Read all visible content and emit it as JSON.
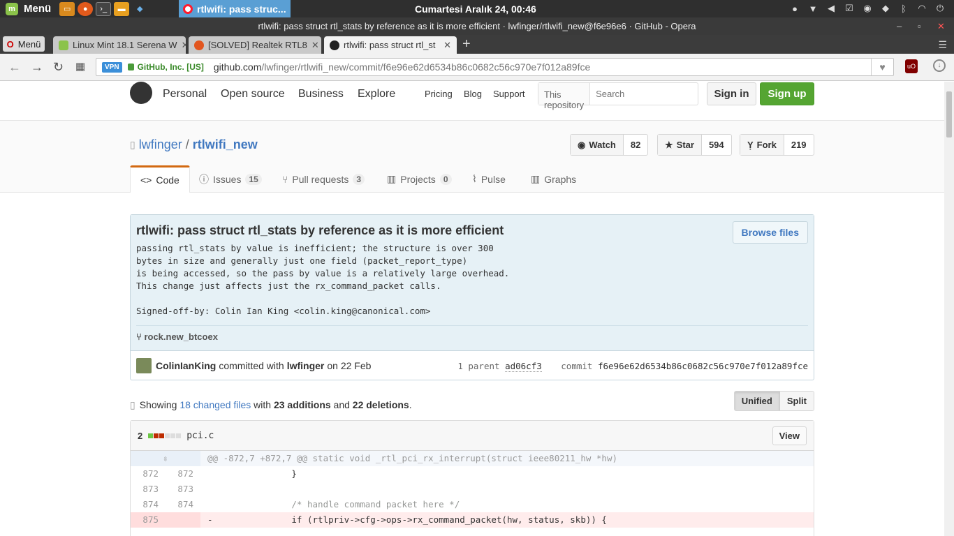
{
  "panel": {
    "menu_label": "Menü",
    "active_task": "rtlwifi: pass struc...",
    "clock": "Cumartesi Aralık 24, 00:46"
  },
  "window": {
    "title": "rtlwifi: pass struct rtl_stats by reference as it is more efficient · lwfinger/rtlwifi_new@f6e96e6 · GitHub - Opera"
  },
  "tabs": {
    "opera_menu": "Menü",
    "items": [
      {
        "label": "Linux Mint 18.1 Serena W"
      },
      {
        "label": "[SOLVED] Realtek RTL8"
      },
      {
        "label": "rtlwifi: pass struct rtl_st"
      }
    ]
  },
  "toolbar": {
    "vpn": "VPN",
    "cert": "GitHub, Inc. [US]",
    "url_host": "github.com",
    "url_path": "/lwfinger/rtlwifi_new/commit/f6e96e62d6534b86c0682c56c970e7f012a89fce"
  },
  "gh": {
    "nav": [
      "Personal",
      "Open source",
      "Business",
      "Explore"
    ],
    "sub": [
      "Pricing",
      "Blog",
      "Support"
    ],
    "search_scope": "This repository",
    "search_placeholder": "Search",
    "signin": "Sign in",
    "signup": "Sign up"
  },
  "repo": {
    "owner": "lwfinger",
    "sep": "/",
    "name": "rtlwifi_new",
    "watch": {
      "label": "Watch",
      "count": "82"
    },
    "star": {
      "label": "Star",
      "count": "594"
    },
    "fork": {
      "label": "Fork",
      "count": "219"
    },
    "tabs": {
      "code": "Code",
      "issues": "Issues",
      "issues_count": "15",
      "pulls": "Pull requests",
      "pulls_count": "3",
      "projects": "Projects",
      "projects_count": "0",
      "pulse": "Pulse",
      "graphs": "Graphs"
    }
  },
  "commit": {
    "title": "rtlwifi: pass struct rtl_stats by reference as it is more efficient",
    "browse": "Browse files",
    "description": "passing rtl_stats by value is inefficient; the structure is over 300\nbytes in size and generally just one field (packet_report_type)\nis being accessed, so the pass by value is a relatively large overhead.\nThis change just affects just the rx_command_packet calls.\n\nSigned-off-by: Colin Ian King <colin.king@canonical.com>",
    "branch": "rock.new_btcoex",
    "author": "ColinIanKing",
    "committed_with": "committed with",
    "committer": "lwfinger",
    "date": "on 22 Feb",
    "parent_label": "1 parent",
    "parent_sha": "ad06cf3",
    "commit_label": "commit",
    "sha": "f6e96e62d6534b86c0682c56c970e7f012a89fce"
  },
  "toc": {
    "showing": "Showing",
    "changed": "18 changed files",
    "with": "with",
    "additions": "23 additions",
    "and": "and",
    "deletions": "22 deletions",
    "period": ".",
    "unified": "Unified",
    "split": "Split"
  },
  "file": {
    "count": "2",
    "name": "pci.c",
    "view": "View",
    "hunk": "@@ -872,7 +872,7 @@ static void _rtl_pci_rx_interrupt(struct ieee80211_hw *hw)",
    "lines": [
      {
        "old": "872",
        "new": "872",
        "code": "                }"
      },
      {
        "old": "873",
        "new": "873",
        "code": ""
      },
      {
        "old": "874",
        "new": "874",
        "code": "                /* handle command packet here */"
      },
      {
        "old": "875",
        "new": "",
        "code": "-               if (rtlpriv->cfg->ops->rx_command_packet(hw, status, skb)) {"
      }
    ]
  }
}
